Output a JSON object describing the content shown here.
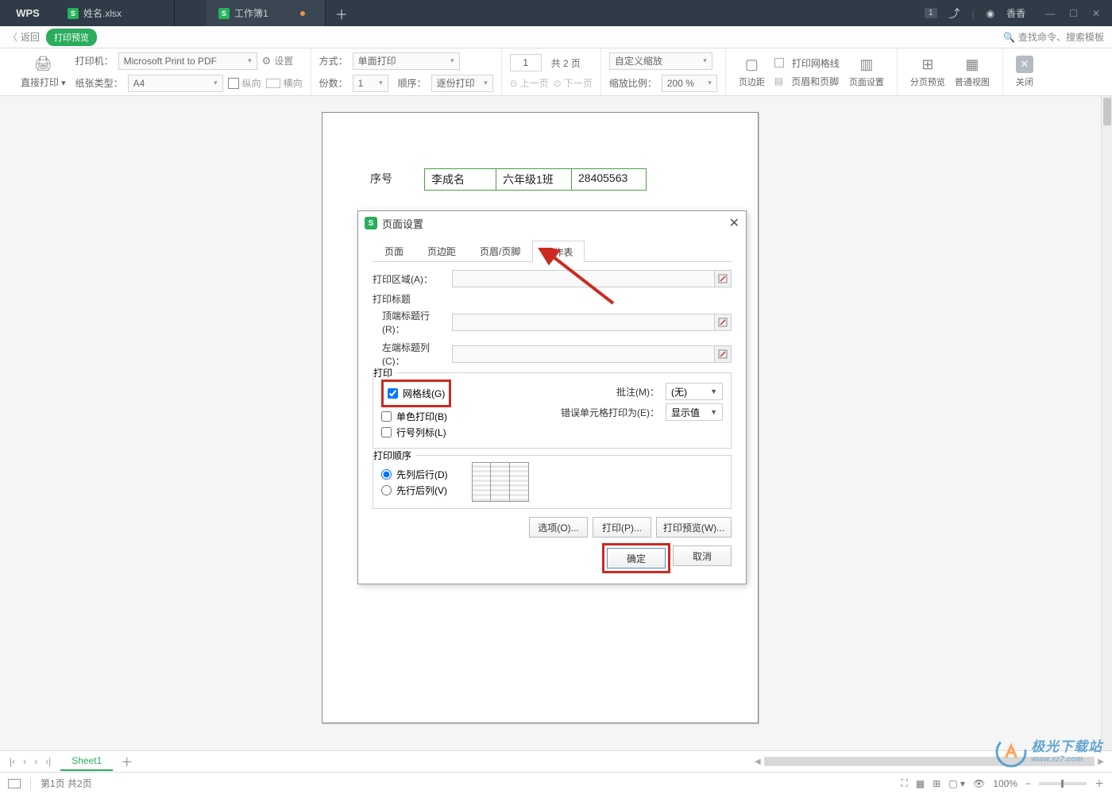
{
  "titlebar": {
    "app": "WPS",
    "tab1": "姓名.xlsx",
    "tab2": "工作簿1",
    "plus": "＋",
    "badge": "1",
    "user": "香香"
  },
  "subheader": {
    "back": "返回",
    "preview": "打印预览",
    "search": "查找命令、搜索模板"
  },
  "toolbar": {
    "direct_print": "直接打印",
    "printer_label": "打印机：",
    "printer_value": "Microsoft Print to PDF",
    "paper_label": "纸张类型：",
    "paper_value": "A4",
    "settings": "设置",
    "portrait": "纵向",
    "landscape": "横向",
    "mode_label": "方式：",
    "mode_value": "单面打印",
    "copies_label": "份数：",
    "copies_value": "1",
    "order_label": "顺序：",
    "order_value": "逐份打印",
    "page_current": "1",
    "page_total": "共 2 页",
    "prev": "上一页",
    "next": "下一页",
    "zoom_custom": "自定义缩放",
    "scale_label": "缩放比例：",
    "scale_value": "200 %",
    "margin": "页边距",
    "print_grid": "打印网格线",
    "headerfooter": "页眉和页脚",
    "pagesetup": "页面设置",
    "page_preview": "分页预览",
    "normal_view": "普通视图",
    "close": "关闭"
  },
  "doc": {
    "rowhead": "序号",
    "c1": "李成名",
    "c2": "六年级1班",
    "c3": "28405563"
  },
  "dialog": {
    "title": "页面设置",
    "tabs": {
      "page": "页面",
      "margin": "页边距",
      "headerfooter": "页眉/页脚",
      "sheet": "工作表"
    },
    "print_area": "打印区域(A)：",
    "print_titles": "打印标题",
    "top_rows": "顶端标题行(R)：",
    "left_cols": "左端标题列(C)：",
    "print_section": "打印",
    "gridlines": "网格线(G)",
    "bw": "单色打印(B)",
    "rowcolhead": "行号列标(L)",
    "comments_label": "批注(M)：",
    "comments_value": "(无)",
    "errors_label": "错误单元格打印为(E)：",
    "errors_value": "显示值",
    "order_section": "打印顺序",
    "order1": "先列后行(D)",
    "order2": "先行后列(V)",
    "options": "选项(O)...",
    "print": "打印(P)...",
    "preview": "打印预览(W)...",
    "ok": "确定",
    "cancel": "取消"
  },
  "sheets": {
    "s1": "Sheet1"
  },
  "statusbar": {
    "page": "第1页 共2页",
    "zoom": "100%"
  },
  "watermark": {
    "ln1": "极光下载站",
    "ln2": "www.xz7.com"
  }
}
